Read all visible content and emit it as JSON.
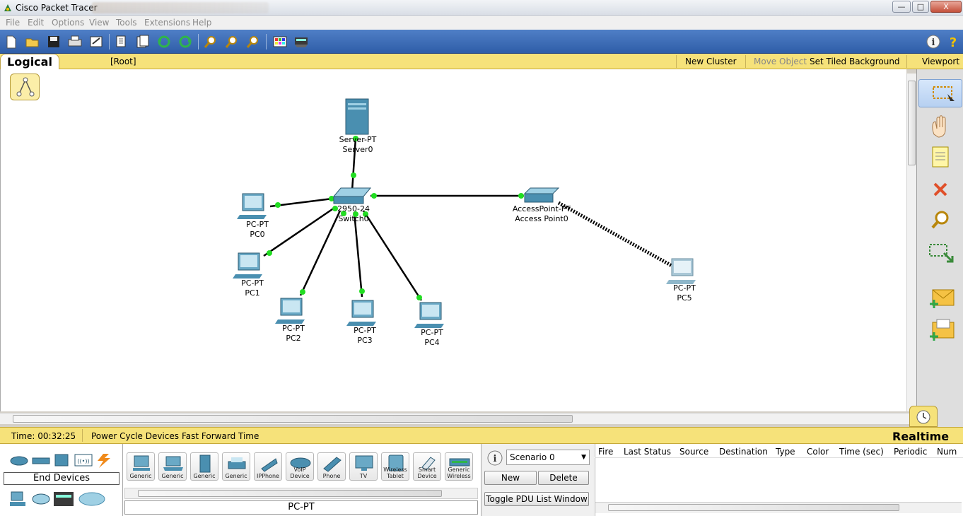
{
  "window": {
    "title": "Cisco Packet Tracer",
    "minimize": "—",
    "maximize": "□",
    "close": "X"
  },
  "menu": [
    "File",
    "Edit",
    "Options",
    "View",
    "Tools",
    "Extensions",
    "Help"
  ],
  "toolbar": {
    "icons": [
      "new-icon",
      "open-icon",
      "save-icon",
      "print-icon",
      "activity-wizard-icon",
      "copy-icon",
      "paste-icon",
      "undo-icon",
      "redo-icon",
      "zoom-in-icon",
      "zoom-reset-icon",
      "zoom-out-icon",
      "palette-icon",
      "custom-device-icon"
    ],
    "info": "i",
    "help": "?"
  },
  "ribbon": {
    "tab": "Logical",
    "root": "[Root]",
    "new_cluster": "New Cluster",
    "move_object": "Move Object",
    "set_tiled_background": "Set Tiled Background",
    "viewport": "Viewport"
  },
  "nodes": {
    "server0": {
      "type": "Server-PT",
      "name": "Server0"
    },
    "switch0": {
      "type": "2950-24",
      "name": "Switch0"
    },
    "ap0": {
      "type": "AccessPoint-PT",
      "name": "Access Point0"
    },
    "pc0": {
      "type": "PC-PT",
      "name": "PC0"
    },
    "pc1": {
      "type": "PC-PT",
      "name": "PC1"
    },
    "pc2": {
      "type": "PC-PT",
      "name": "PC2"
    },
    "pc3": {
      "type": "PC-PT",
      "name": "PC3"
    },
    "pc4": {
      "type": "PC-PT",
      "name": "PC4"
    },
    "pc5": {
      "type": "PC-PT",
      "name": "PC5"
    }
  },
  "right_tools": [
    "select-icon",
    "move-hand-icon",
    "note-icon",
    "delete-icon",
    "inspect-icon",
    "resize-shape-icon",
    "add-simple-pdu-icon",
    "add-complex-pdu-icon"
  ],
  "status": {
    "time": "Time: 00:32:25",
    "power_cycle": "Power Cycle Devices",
    "fast_forward": "Fast Forward Time",
    "mode": "Realtime"
  },
  "categories": {
    "label": "End Devices",
    "icons": [
      "router-category-icon",
      "switch-category-icon",
      "hub-category-icon",
      "wireless-category-icon",
      "connections-category-icon",
      "end-devices-category-icon",
      "wan-emulation-category-icon",
      "custom-device-category-icon",
      "multiuser-category-icon"
    ]
  },
  "devices": {
    "tiles": [
      "Generic",
      "Generic",
      "Generic",
      "Generic",
      "IPPhone",
      "VoIP Device",
      "Phone",
      "TV",
      "Wireless Tablet",
      "Smart Device",
      "Generic Wireless"
    ],
    "selected": "PC-PT"
  },
  "scenario": {
    "value": "Scenario 0",
    "new": "New",
    "delete": "Delete",
    "toggle": "Toggle PDU List Window"
  },
  "pdu_columns": [
    "Fire",
    "Last Status",
    "Source",
    "Destination",
    "Type",
    "Color",
    "Time (sec)",
    "Periodic",
    "Num"
  ],
  "colors": {
    "toolbar": "#3a6ab5",
    "ribbon": "#f6e27a",
    "link_up": "#22dd22",
    "device": "#4a8fb0"
  }
}
